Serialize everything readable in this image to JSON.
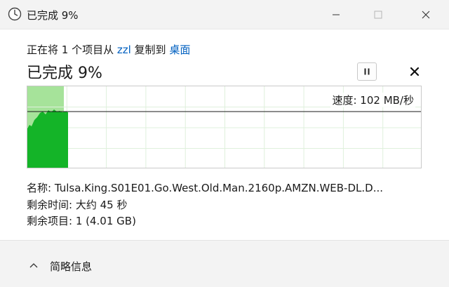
{
  "window": {
    "title": "已完成 9%"
  },
  "copy": {
    "line_prefix": "正在将 1 个项目从 ",
    "source": "zzl",
    "line_middle": " 复制到 ",
    "destination": "桌面",
    "progress_title": "已完成 9%",
    "progress_fraction": 0.09,
    "speed_label": "速度: 102 MB/秒"
  },
  "details": {
    "name_label": "名称: ",
    "name_value": "Tulsa.King.S01E01.Go.West.Old.Man.2160p.AMZN.WEB-DL.D...",
    "time_label": "剩余时间: ",
    "time_value": "大约 45 秒",
    "items_label": "剩余项目: ",
    "items_value": "1 (4.01 GB)"
  },
  "footer": {
    "fewer_details_label": "简略信息"
  },
  "colors": {
    "accent_link": "#0060c0",
    "graph_fill": "#14b428",
    "graph_progress_bg": "#a6e39a",
    "graph_grid": "#dff0dc"
  }
}
